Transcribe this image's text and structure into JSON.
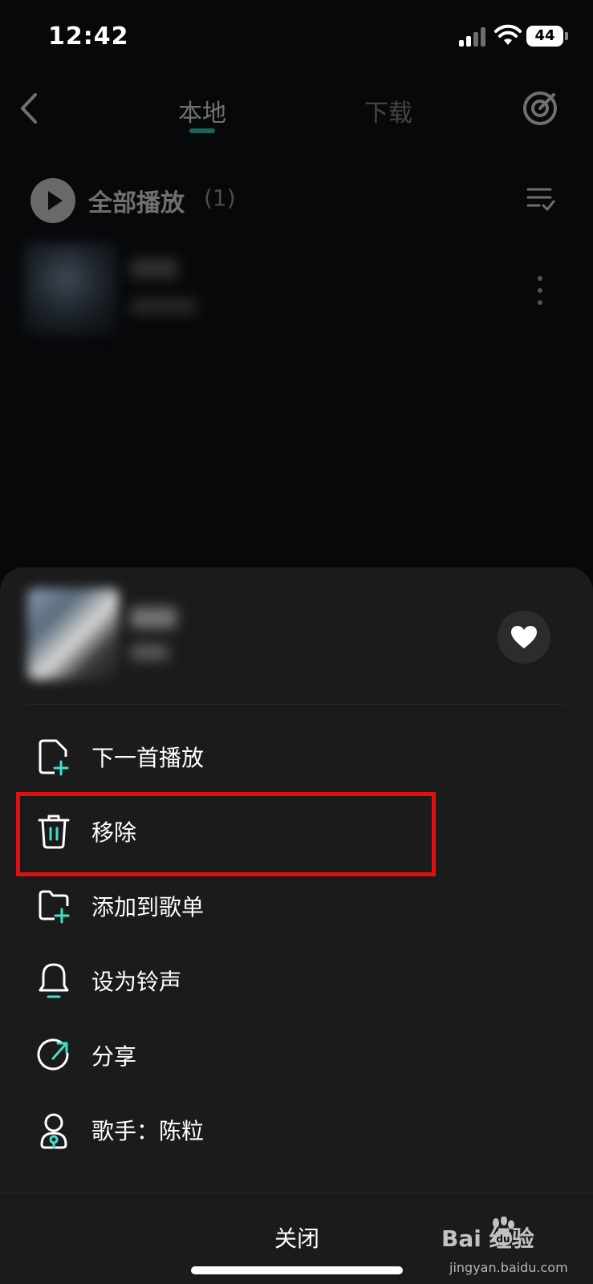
{
  "status_bar": {
    "time": "12:42",
    "battery": "44"
  },
  "header": {
    "tabs": [
      {
        "label": "本地",
        "active": true
      },
      {
        "label": "下载",
        "active": false
      }
    ],
    "accent_color": "#3fe0c8"
  },
  "play_all": {
    "label": "全部播放",
    "count": "(1)"
  },
  "sheet": {
    "menu": [
      {
        "label": "下一首播放",
        "icon": "folder-plus-icon"
      },
      {
        "label": "移除",
        "icon": "trash-icon"
      },
      {
        "label": "添加到歌单",
        "icon": "folder-add-icon"
      },
      {
        "label": "设为铃声",
        "icon": "bell-icon"
      },
      {
        "label": "分享",
        "icon": "share-icon"
      },
      {
        "label": "歌手：陈粒",
        "icon": "singer-icon"
      }
    ],
    "close_label": "关闭",
    "highlight_color": "#e01010"
  },
  "watermark": {
    "logo": "Bai  经验",
    "url": "jingyan.baidu.com"
  }
}
